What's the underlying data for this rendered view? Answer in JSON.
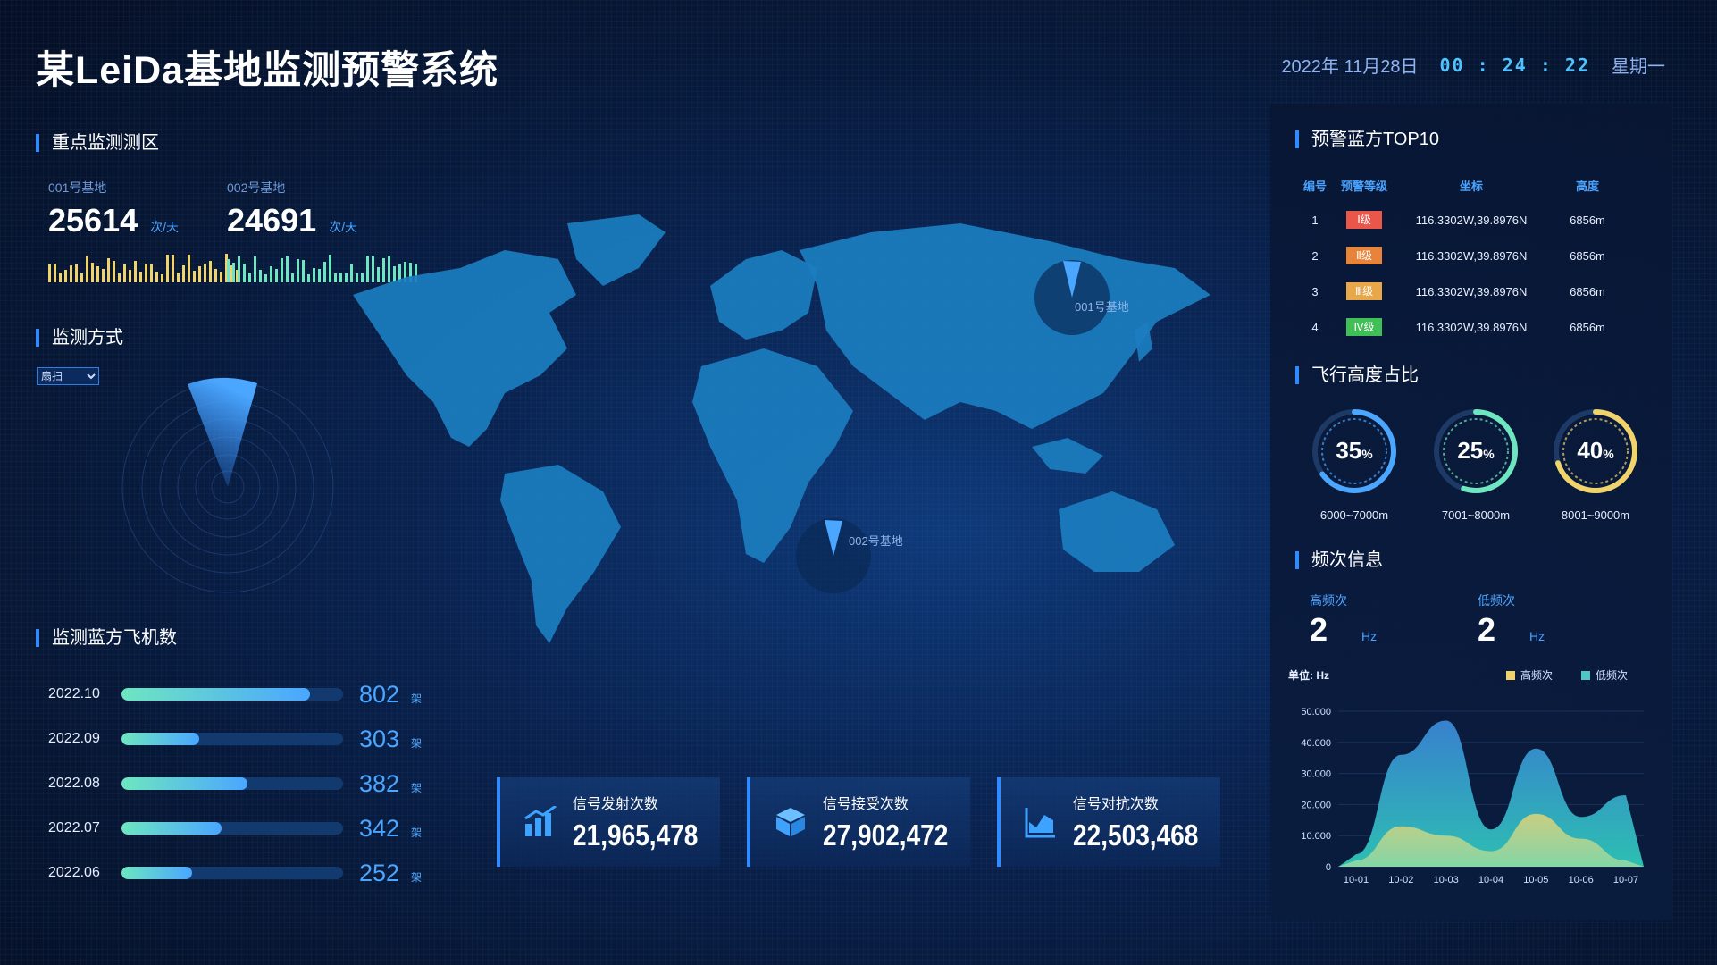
{
  "header": {
    "title": "某LeiDa基地监测预警系统",
    "date": "2022年 11月28日",
    "time": "00 : 24 : 22",
    "weekday": "星期一"
  },
  "key_zone": {
    "title": "重点监测测区",
    "bases": [
      {
        "name": "001号基地",
        "value": "25614",
        "unit": "次/天",
        "color": "#f0d36a"
      },
      {
        "name": "002号基地",
        "value": "24691",
        "unit": "次/天",
        "color": "#6ee6c0"
      }
    ]
  },
  "monitor_mode": {
    "title": "监测方式",
    "selected": "扇扫"
  },
  "aircraft_count": {
    "title": "监测蓝方飞机数",
    "unit": "架",
    "rows": [
      {
        "label": "2022.10",
        "value": "802",
        "fraction": 0.85
      },
      {
        "label": "2022.09",
        "value": "303",
        "fraction": 0.35
      },
      {
        "label": "2022.08",
        "value": "382",
        "fraction": 0.57
      },
      {
        "label": "2022.07",
        "value": "342",
        "fraction": 0.45
      },
      {
        "label": "2022.06",
        "value": "252",
        "fraction": 0.32
      }
    ]
  },
  "map": {
    "base1": "001号基地",
    "base2": "002号基地"
  },
  "stats": [
    {
      "label": "信号发射次数",
      "value": "21,965,478",
      "icon": "bar-chart-icon"
    },
    {
      "label": "信号接受次数",
      "value": "27,902,472",
      "icon": "cube-icon"
    },
    {
      "label": "信号对抗次数",
      "value": "22,503,468",
      "icon": "area-chart-icon"
    }
  ],
  "top10": {
    "title": "预警蓝方TOP10",
    "headers": [
      "编号",
      "预警等级",
      "坐标",
      "高度"
    ],
    "rows": [
      {
        "id": "1",
        "level": "Ⅰ级",
        "level_color": "#e8574a",
        "coord": "116.3302W,39.8976N",
        "height": "6856m"
      },
      {
        "id": "2",
        "level": "Ⅱ级",
        "level_color": "#e8843a",
        "coord": "116.3302W,39.8976N",
        "height": "6856m"
      },
      {
        "id": "3",
        "level": "Ⅲ级",
        "level_color": "#e8a84a",
        "coord": "116.3302W,39.8976N",
        "height": "6856m"
      },
      {
        "id": "4",
        "level": "Ⅳ级",
        "level_color": "#3fbf55",
        "coord": "116.3302W,39.8976N",
        "height": "6856m"
      }
    ]
  },
  "altitude": {
    "title": "飞行高度占比",
    "rings": [
      {
        "pct": "35",
        "sym": "%",
        "value": 35,
        "label": "6000~7000m",
        "color": "#4aa6ff"
      },
      {
        "pct": "25",
        "sym": "%",
        "value": 25,
        "label": "7001~8000m",
        "color": "#6ee6c0"
      },
      {
        "pct": "40",
        "sym": "%",
        "value": 40,
        "label": "8001~9000m",
        "color": "#f0d36a"
      }
    ]
  },
  "frequency": {
    "title": "频次信息",
    "high_label": "高频次",
    "high_value": "2",
    "low_label": "低频次",
    "low_value": "2",
    "unit": "Hz"
  },
  "chart_data": {
    "type": "area",
    "ylabel": "单位: Hz",
    "categories": [
      "10-01",
      "10-02",
      "10-03",
      "10-04",
      "10-05",
      "10-06",
      "10-07"
    ],
    "ylim": [
      0,
      50000
    ],
    "yticks": [
      "50.000",
      "40.000",
      "30.000",
      "20.000",
      "10.000",
      "0"
    ],
    "legend_position": "top-right",
    "series": [
      {
        "name": "高频次",
        "color": "#f0d36a",
        "values": [
          2000,
          13000,
          10000,
          5000,
          17000,
          9000,
          2000
        ]
      },
      {
        "name": "低频次",
        "color": "#4ec7c4",
        "values": [
          4000,
          36000,
          47000,
          12000,
          38000,
          16000,
          23000
        ]
      }
    ]
  }
}
